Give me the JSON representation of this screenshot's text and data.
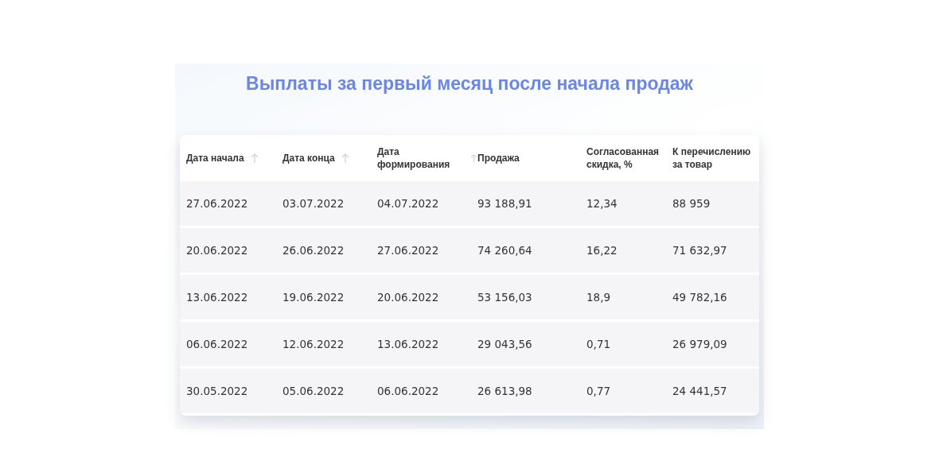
{
  "title": "Выплаты за первый месяц после начала продаж",
  "table": {
    "columns": [
      {
        "label": "Дата начала",
        "sortable": true
      },
      {
        "label": "Дата конца",
        "sortable": true
      },
      {
        "label": "Дата формирования",
        "sortable": true
      },
      {
        "label": "Продажа",
        "sortable": false
      },
      {
        "label": "Согласованная скидка, %",
        "sortable": false
      },
      {
        "label": "К перечислению за товар",
        "sortable": false
      }
    ],
    "rows": [
      [
        "27.06.2022",
        "03.07.2022",
        "04.07.2022",
        "93 188,91",
        "12,34",
        "88 959"
      ],
      [
        "20.06.2022",
        "26.06.2022",
        "27.06.2022",
        "74 260,64",
        "16,22",
        "71 632,97"
      ],
      [
        "13.06.2022",
        "19.06.2022",
        "20.06.2022",
        "53 156,03",
        "18,9",
        "49 782,16"
      ],
      [
        "06.06.2022",
        "12.06.2022",
        "13.06.2022",
        "29 043,56",
        "0,71",
        "26 979,09"
      ],
      [
        "30.05.2022",
        "05.06.2022",
        "06.06.2022",
        "26 613,98",
        "0,77",
        "24 441,57"
      ]
    ]
  }
}
